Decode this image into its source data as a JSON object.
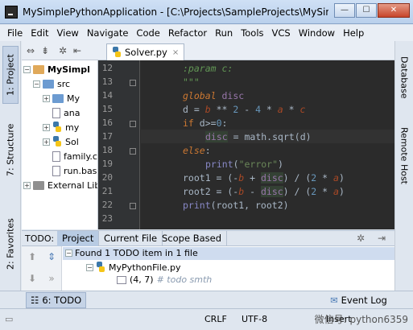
{
  "window": {
    "title": "MySimplePythonApplication - [C:\\Projects\\SampleProjects\\MySimplePy",
    "minimize": "—",
    "maximize": "☐",
    "close": "✕"
  },
  "menu": [
    "File",
    "Edit",
    "View",
    "Navigate",
    "Code",
    "Refactor",
    "Run",
    "Tools",
    "VCS",
    "Window",
    "Help"
  ],
  "left_tabs": [
    "1: Project",
    "7: Structure",
    "2: Favorites"
  ],
  "right_tabs": [
    "Database",
    "Remote Host"
  ],
  "editor_tab": {
    "label": "Solver.py",
    "close": "×"
  },
  "project_tree": [
    {
      "label": "MySimpl",
      "bold": true
    },
    {
      "label": "src"
    },
    {
      "label": "My"
    },
    {
      "label": "ana"
    },
    {
      "label": "my"
    },
    {
      "label": "Sol"
    },
    {
      "label": "family.c"
    },
    {
      "label": "run.bas"
    },
    {
      "label": "External Lib"
    }
  ],
  "code": {
    "line_numbers": [
      "12",
      "13",
      "14",
      "15",
      "16",
      "17",
      "18",
      "19",
      "20",
      "21",
      "22",
      "23"
    ],
    "lines": [
      ":param c:",
      "\"\"\"",
      "global disc",
      "d = b ** 2 - 4 * a * c",
      "if d>=0:",
      "disc = math.sqrt(d)",
      "else:",
      "print(\"error\")",
      "root1 = (-b + disc) / (2 * a)",
      "root2 = (-b - disc) / (2 * a)",
      "print(root1, root2)",
      ""
    ]
  },
  "todo": {
    "label": "TODO:",
    "tabs": [
      "Project",
      "Current File",
      "Scope Based"
    ],
    "summary": "Found 1 TODO item in 1 file",
    "file": "MyPythonFile.py",
    "item_pos": "(4, 7)",
    "item_text": "# todo smth"
  },
  "bottom_tabs": {
    "todo": "6: TODO",
    "event_log": "Event Log"
  },
  "status": {
    "line_sep": "CRLF",
    "encoding": "UTF-8",
    "mode": "Insert",
    "watermark": "微信号: python6359"
  }
}
